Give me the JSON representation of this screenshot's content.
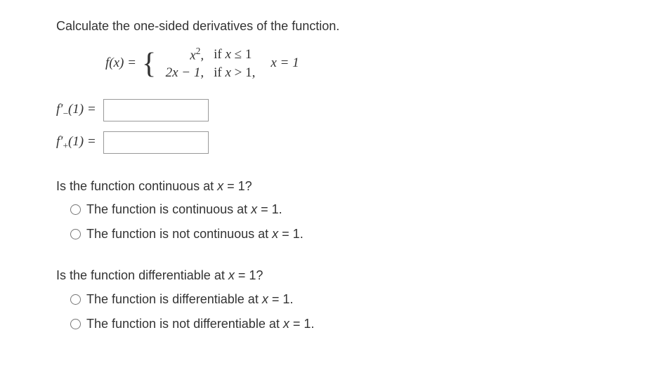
{
  "prompt": "Calculate the one-sided derivatives of the function.",
  "equation": {
    "lhs": "f(x) = ",
    "case1_expr_html": "x<sup class='exp'>2</sup>,",
    "case1_cond_html": "if  <span class='ital'>x</span> ≤ 1",
    "case2_expr_html": "2<span class='ital'>x</span> − 1,",
    "case2_cond_html": "if  <span class='ital'>x</span> > 1,",
    "point": "x = 1"
  },
  "inputs": {
    "left_deriv_label_html": "f′<span class='sub'>−</span>(1)  =",
    "right_deriv_label_html": "f′<span class='sub'>+</span>(1)  =",
    "left_value": "",
    "right_value": ""
  },
  "q1": {
    "question_html": "Is the function continuous at  <span class='ital'>x</span> = 1?",
    "opt1_html": "The function is continuous at <span class='ital'>x</span> = 1.",
    "opt2_html": "The function is not continuous at <span class='ital'>x</span> = 1."
  },
  "q2": {
    "question_html": "Is the function differentiable at  <span class='ital'>x</span> = 1?",
    "opt1_html": "The function is differentiable at <span class='ital'>x</span> = 1.",
    "opt2_html": "The function is not differentiable at <span class='ital'>x</span> = 1."
  }
}
